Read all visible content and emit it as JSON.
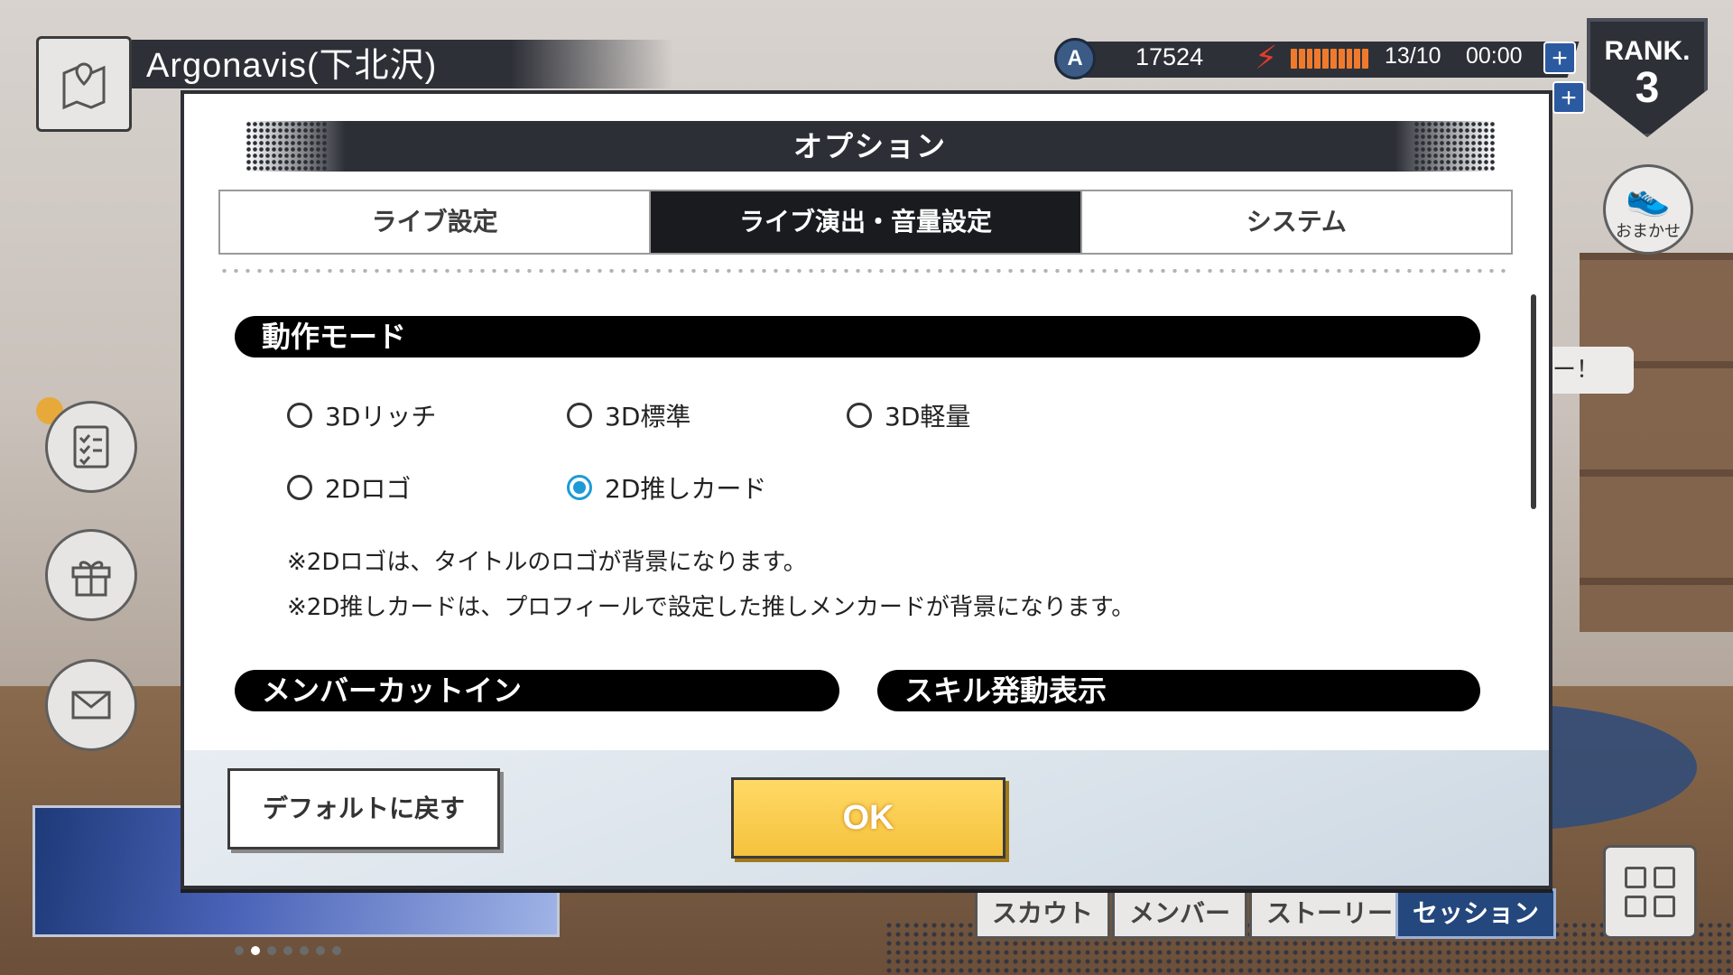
{
  "hud": {
    "location": "Argonavis(下北沢)",
    "gems": "17524",
    "stamina": "13/10",
    "stamina_timer": "00:00",
    "plus_symbol": "+",
    "rank_label": "RANK.",
    "rank_value": "3",
    "omakase_label": "おまかせ",
    "side_bubble": "ー！",
    "gem_letter": "A"
  },
  "bottom_nav": [
    "スカウト",
    "メンバー",
    "ストーリー",
    "セッション"
  ],
  "modal": {
    "title": "オプション",
    "tabs": [
      "ライブ設定",
      "ライブ演出・音量設定",
      "システム"
    ],
    "active_tab": 1,
    "section_mode": "動作モード",
    "mode_options": [
      "3Dリッチ",
      "3D標準",
      "3D軽量",
      "2Dロゴ",
      "2D推しカード"
    ],
    "selected_mode": "2D推しカード",
    "notes": [
      "※2Dロゴは、タイトルのロゴが背景になります。",
      "※2D推しカードは、プロフィールで設定した推しメンカードが背景になります。"
    ],
    "section_cutin": "メンバーカットイン",
    "section_skill": "スキル発動表示",
    "default_button": "デフォルトに戻す",
    "ok_button": "OK"
  },
  "colors": {
    "accent_blue": "#1d9bd6",
    "ok_yellow": "#f5c23d",
    "dark": "#1a1b1f"
  },
  "icons": {
    "location": "map-icon",
    "gem": "gem-icon",
    "stamina": "bolt-icon",
    "omakase": "shoe-icon",
    "side_buttons": [
      "checklist-icon",
      "gift-icon",
      "mail-icon"
    ],
    "grid": "grid-icon"
  }
}
